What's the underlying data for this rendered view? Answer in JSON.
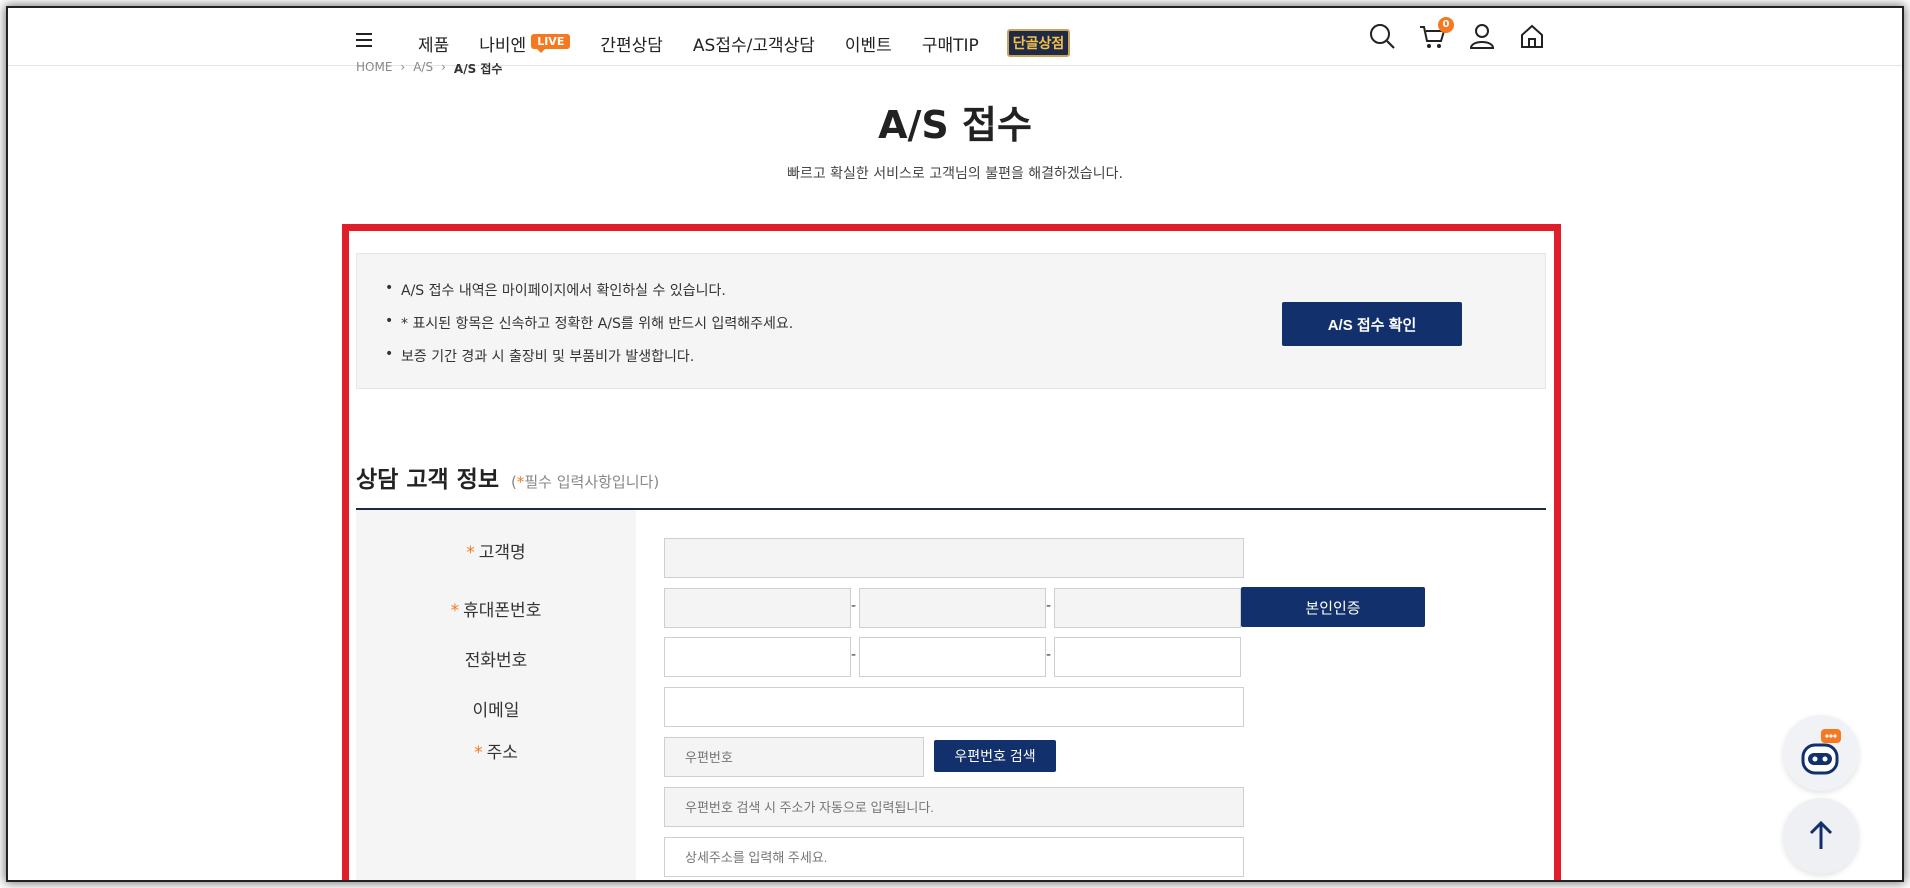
{
  "header": {
    "nav": [
      {
        "label": "제품"
      },
      {
        "label": "나비엔"
      },
      {
        "label": "간편상담"
      },
      {
        "label": "AS접수/고객상담"
      },
      {
        "label": "이벤트"
      },
      {
        "label": "구매TIP"
      }
    ],
    "live_badge": "LIVE",
    "special_label": "단골상점",
    "cart_count": "0",
    "accent_color": "#f47920",
    "icons": [
      "menu-icon",
      "search-icon",
      "cart-icon",
      "user-icon",
      "home-icon"
    ]
  },
  "breadcrumb": [
    "HOME",
    "A/S",
    "A/S 접수"
  ],
  "page": {
    "title": "A/S 접수",
    "subtitle": "빠르고 확실한 서비스로 고객님의 불편을 해결하겠습니다."
  },
  "notice": {
    "items": [
      "A/S 접수 내역은 마이페이지에서 확인하실 수 있습니다.",
      "* 표시된 항목은 신속하고 정확한 A/S를 위해 반드시 입력해주세요.",
      "보증 기간 경과 시 출장비 및 부품비가 발생합니다."
    ],
    "check_button": "A/S 접수 확인"
  },
  "form": {
    "section_title": "상담 고객 정보",
    "required_note_open": "(",
    "required_note_star": "*",
    "required_note_text": "필수 입력사항입니다)",
    "required_star": "*",
    "labels": {
      "name": "고객명",
      "mobile": "휴대폰번호",
      "phone": "전화번호",
      "email": "이메일",
      "address": "주소"
    },
    "separator": "-",
    "verify_button": "본인인증",
    "zip_placeholder": "우편번호",
    "zip_search_button": "우편번호 검색",
    "address_auto_placeholder": "우편번호 검색 시 주소가 자동으로 입력됩니다.",
    "address_detail_placeholder": "상세주소를 입력해 주세요."
  },
  "colors": {
    "navy": "#12306b",
    "highlight_border": "#e01e2a"
  }
}
